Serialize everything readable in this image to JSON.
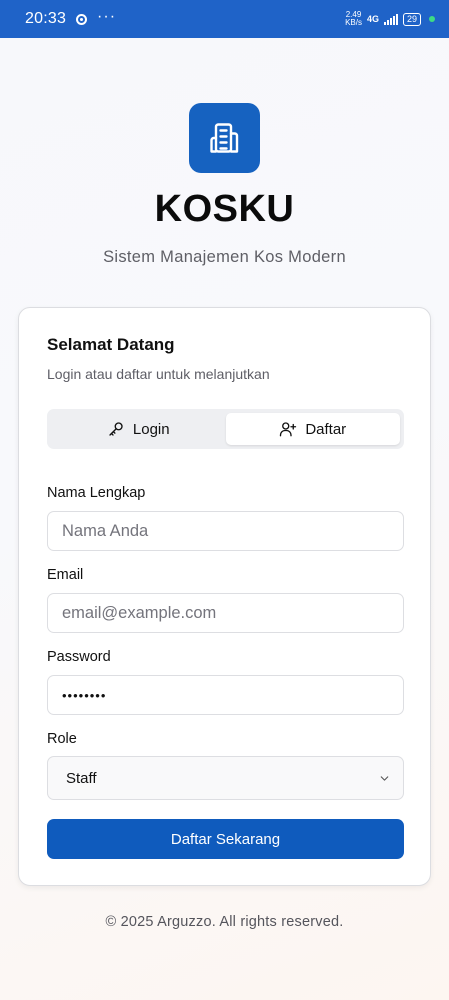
{
  "status_bar": {
    "time": "20:33",
    "speed_value": "2.49",
    "speed_unit": "KB/s",
    "network": "4G",
    "battery": "29"
  },
  "app": {
    "title": "KOSKU",
    "subtitle": "Sistem Manajemen Kos Modern",
    "brand_color": "#1662c0"
  },
  "card": {
    "title": "Selamat Datang",
    "description": "Login atau daftar untuk melanjutkan"
  },
  "tabs": [
    {
      "label": "Login",
      "icon": "key-icon",
      "active": false
    },
    {
      "label": "Daftar",
      "icon": "user-plus-icon",
      "active": true
    }
  ],
  "form": {
    "name_label": "Nama Lengkap",
    "name_placeholder": "Nama Anda",
    "email_label": "Email",
    "email_placeholder": "email@example.com",
    "password_label": "Password",
    "password_value": "••••••••",
    "role_label": "Role",
    "role_value": "Staff",
    "submit_label": "Daftar Sekarang"
  },
  "footer": {
    "text": "© 2025 Arguzzo. All rights reserved."
  }
}
